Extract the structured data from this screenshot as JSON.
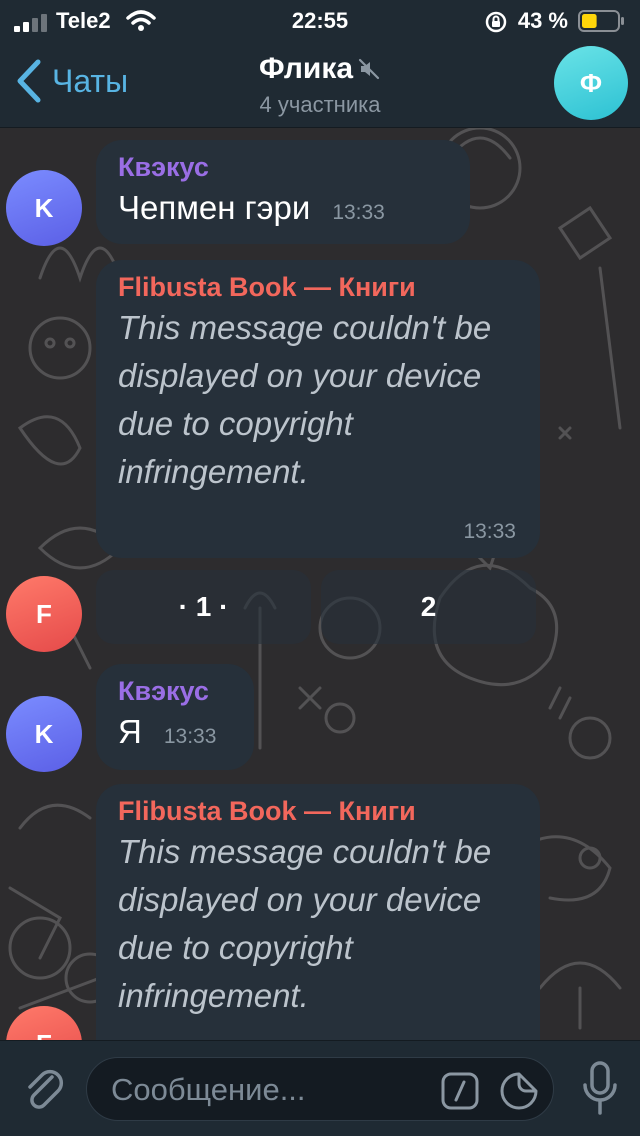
{
  "status_bar": {
    "carrier": "Tele2",
    "time": "22:55",
    "battery_percent": "43 %",
    "battery_level": 0.43,
    "battery_color": "#ffd60a"
  },
  "header": {
    "back_label": "Чаты",
    "title": "Флика",
    "subtitle": "4 участника",
    "avatar_letter": "Ф",
    "accent": "#58b4e3"
  },
  "messages": [
    {
      "sender": "Квэкус",
      "avatar_letter": "K",
      "text": "Чепмен гэри",
      "time": "13:33"
    },
    {
      "sender": "Flibusta Book — Книги",
      "avatar_letter": "F",
      "text": "This message couldn't be displayed on your device due to copyright infringement.",
      "time": "13:33"
    },
    {
      "sender": "Квэкус",
      "avatar_letter": "K",
      "text": "Я",
      "time": "13:33"
    },
    {
      "sender": "Flibusta Book — Книги",
      "avatar_letter": "F",
      "text": "This message couldn't be displayed on your device due to copyright infringement."
    }
  ],
  "inline_keyboard": [
    "· 1 ·",
    "2"
  ],
  "composer": {
    "placeholder": "Сообщение..."
  },
  "icons": [
    "signal-icon",
    "wifi-icon",
    "orientation-lock-icon",
    "battery-icon",
    "back-chevron-icon",
    "mute-icon",
    "attach-icon",
    "bot-command-icon",
    "sticker-icon",
    "microphone-icon"
  ]
}
